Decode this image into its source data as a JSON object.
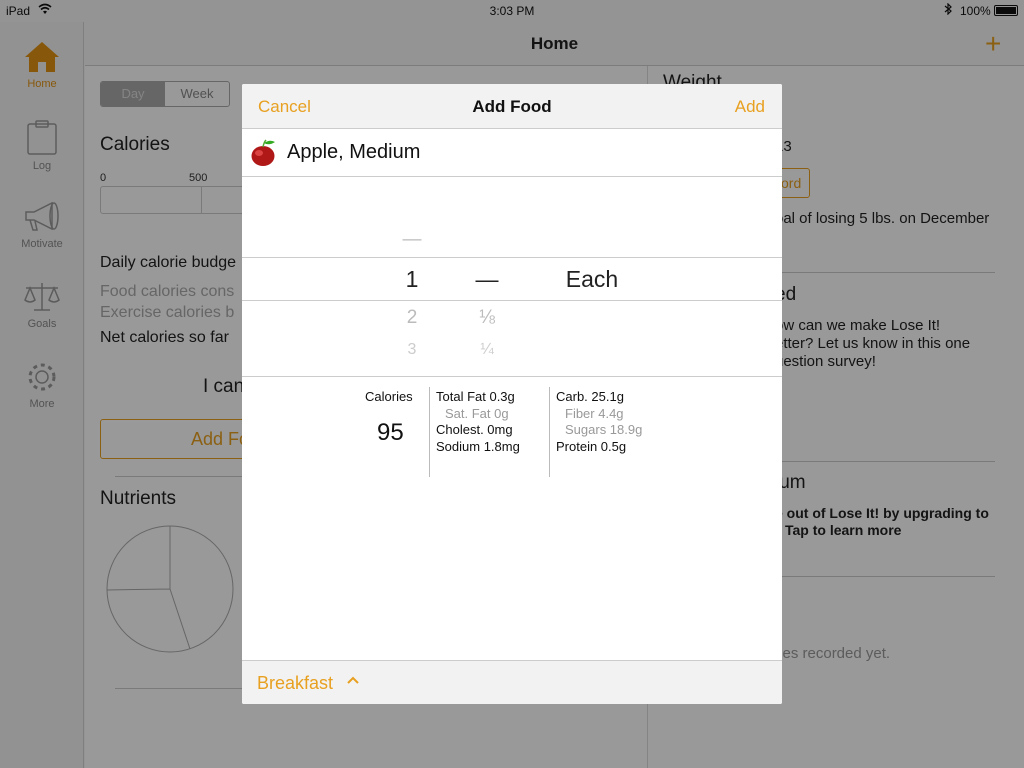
{
  "status": {
    "device": "iPad",
    "time": "3:03 PM",
    "battery": "100%"
  },
  "sidebar": {
    "items": [
      {
        "label": "Home",
        "icon": "home-icon",
        "active": true
      },
      {
        "label": "Log",
        "icon": "clipboard-icon",
        "active": false
      },
      {
        "label": "Motivate",
        "icon": "megaphone-icon",
        "active": false
      },
      {
        "label": "Goals",
        "icon": "scale-icon",
        "active": false
      },
      {
        "label": "More",
        "icon": "gear-icon",
        "active": false
      }
    ]
  },
  "header": {
    "title": "Home",
    "add_icon": "plus-icon"
  },
  "background": {
    "tabs": [
      "Day",
      "Week"
    ],
    "calories_title": "Calories",
    "ticks": [
      "0",
      "500"
    ],
    "budget_label": "Daily calorie budge",
    "food_label": "Food calories cons",
    "exercise_label": "Exercise calories b",
    "net_label": "Net calories so far",
    "can_text": "I can",
    "add_food_button": "Add Fo",
    "nutrients_title": "Nutrients",
    "weight_title": "Weight",
    "date_fragment": "13",
    "record_button": "ord",
    "goal_text": "oal of losing 5 lbs. on December",
    "featured_title": "ed",
    "feedback_text": [
      "ow can we make Lose It!",
      "etter? Let us know in this one",
      "uestion survey!"
    ],
    "premium_title": "ium",
    "upgrade_text": "e out of Lose It! by upgrading to",
    "learn_more": "Tap to learn more",
    "activities_text": "ties recorded yet."
  },
  "modal": {
    "cancel": "Cancel",
    "title": "Add Food",
    "add": "Add",
    "food_name": "Apple, Medium",
    "food_icon": "apple-icon",
    "picker": {
      "amount_above": "—",
      "amount_selected": "1",
      "amount_below": [
        "2",
        "3"
      ],
      "fraction_selected": "—",
      "fraction_below": [
        "⅛",
        "¼"
      ],
      "unit_selected": "Each"
    },
    "nutrition": {
      "calories_label": "Calories",
      "calories_value": "95",
      "total_fat": "Total Fat 0.3g",
      "sat_fat": "Sat. Fat 0g",
      "cholesterol": "Cholest. 0mg",
      "sodium": "Sodium 1.8mg",
      "carb": "Carb. 25.1g",
      "fiber": "Fiber 4.4g",
      "sugars": "Sugars 18.9g",
      "protein": "Protein 0.5g"
    },
    "meal": "Breakfast",
    "meal_icon": "chevron-up-icon"
  }
}
